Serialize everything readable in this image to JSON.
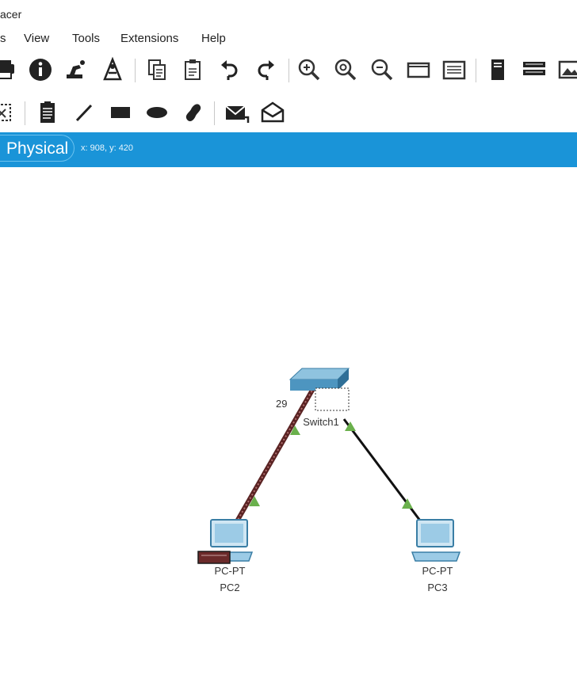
{
  "app": {
    "title_fragment": "acer"
  },
  "menu": [
    "s",
    "View",
    "Tools",
    "Extensions",
    "Help"
  ],
  "toolbar1": {
    "icons": [
      "print-icon",
      "info-icon",
      "activity-wizard-icon",
      "custom-device-icon",
      "copy-icon",
      "paste-icon",
      "undo-icon",
      "redo-icon",
      "zoom-in-icon",
      "zoom-reset-icon",
      "zoom-out-icon",
      "drawing-palette-icon",
      "custom-devices-dialog-icon",
      "view-command-log-icon",
      "cluster-icon",
      "image-icon"
    ]
  },
  "toolbar2": {
    "icons": [
      "select-icon",
      "note-icon",
      "line-icon",
      "rectangle-icon",
      "ellipse-icon",
      "freeform-icon",
      "simple-pdu-icon",
      "complex-pdu-icon"
    ]
  },
  "mode": {
    "label": "Physical",
    "coordinates": "x: 908, y: 420"
  },
  "topology": {
    "switch": {
      "model_fragment": "29",
      "name": "Switch1"
    },
    "pcs": [
      {
        "model": "PC-PT",
        "name": "PC2"
      },
      {
        "model": "PC-PT",
        "name": "PC3"
      }
    ],
    "colors": {
      "link_up": "#6ab04c",
      "blue_bar": "#1a94d8",
      "selected_cable": "#6b2a2a"
    }
  }
}
